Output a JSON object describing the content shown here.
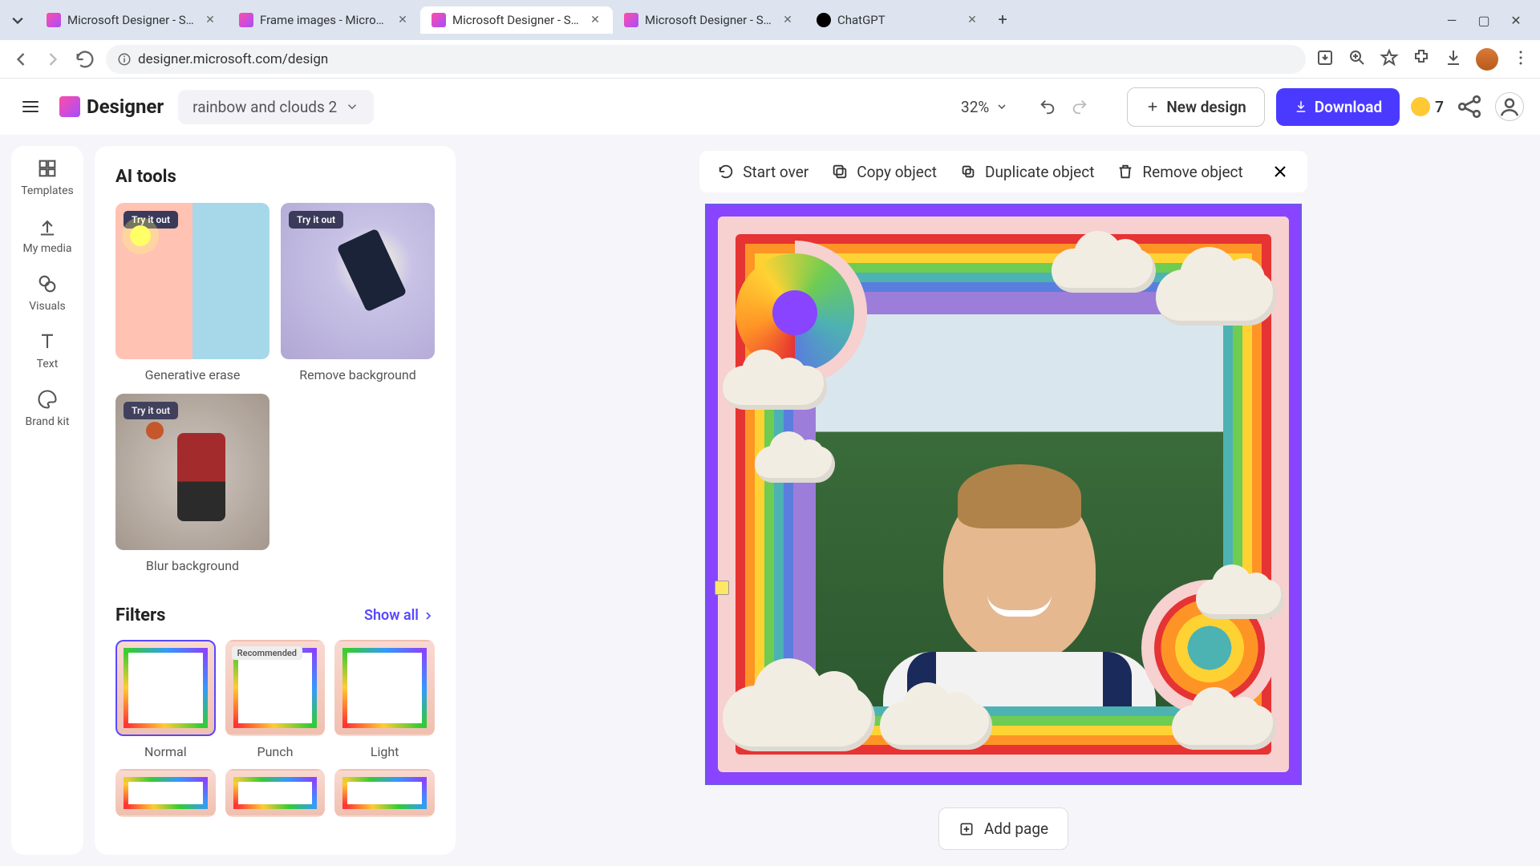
{
  "browser": {
    "tabs": [
      {
        "title": "Microsoft Designer - Stunning",
        "favicon": "designer"
      },
      {
        "title": "Frame images - Microsoft Des",
        "favicon": "designer"
      },
      {
        "title": "Microsoft Designer - Stunning",
        "favicon": "designer",
        "active": true
      },
      {
        "title": "Microsoft Designer - Stunning",
        "favicon": "designer"
      },
      {
        "title": "ChatGPT",
        "favicon": "chatgpt"
      }
    ],
    "url": "designer.microsoft.com/design"
  },
  "app": {
    "logo_text": "Designer",
    "design_name": "rainbow and clouds 2",
    "zoom": "32%",
    "new_design_label": "New design",
    "download_label": "Download",
    "coins": "7"
  },
  "side_rail": {
    "items": [
      "Templates",
      "My media",
      "Visuals",
      "Text",
      "Brand kit"
    ]
  },
  "panel": {
    "ai_section_title": "AI tools",
    "try_badge": "Try it out",
    "ai_tools": [
      {
        "label": "Generative erase",
        "badge": true,
        "thumb": "gen"
      },
      {
        "label": "Remove background",
        "badge": true,
        "thumb": "remove"
      },
      {
        "label": "Blur background",
        "badge": true,
        "thumb": "blur"
      }
    ],
    "filters_title": "Filters",
    "show_all_label": "Show all",
    "recommended_badge": "Recommended",
    "filters": [
      {
        "label": "Normal",
        "selected": true
      },
      {
        "label": "Punch",
        "recommended": true
      },
      {
        "label": "Light"
      }
    ]
  },
  "toolbar": {
    "start_over": "Start over",
    "copy_object": "Copy object",
    "duplicate_object": "Duplicate object",
    "remove_object": "Remove object"
  },
  "footer": {
    "add_page_label": "Add page"
  }
}
